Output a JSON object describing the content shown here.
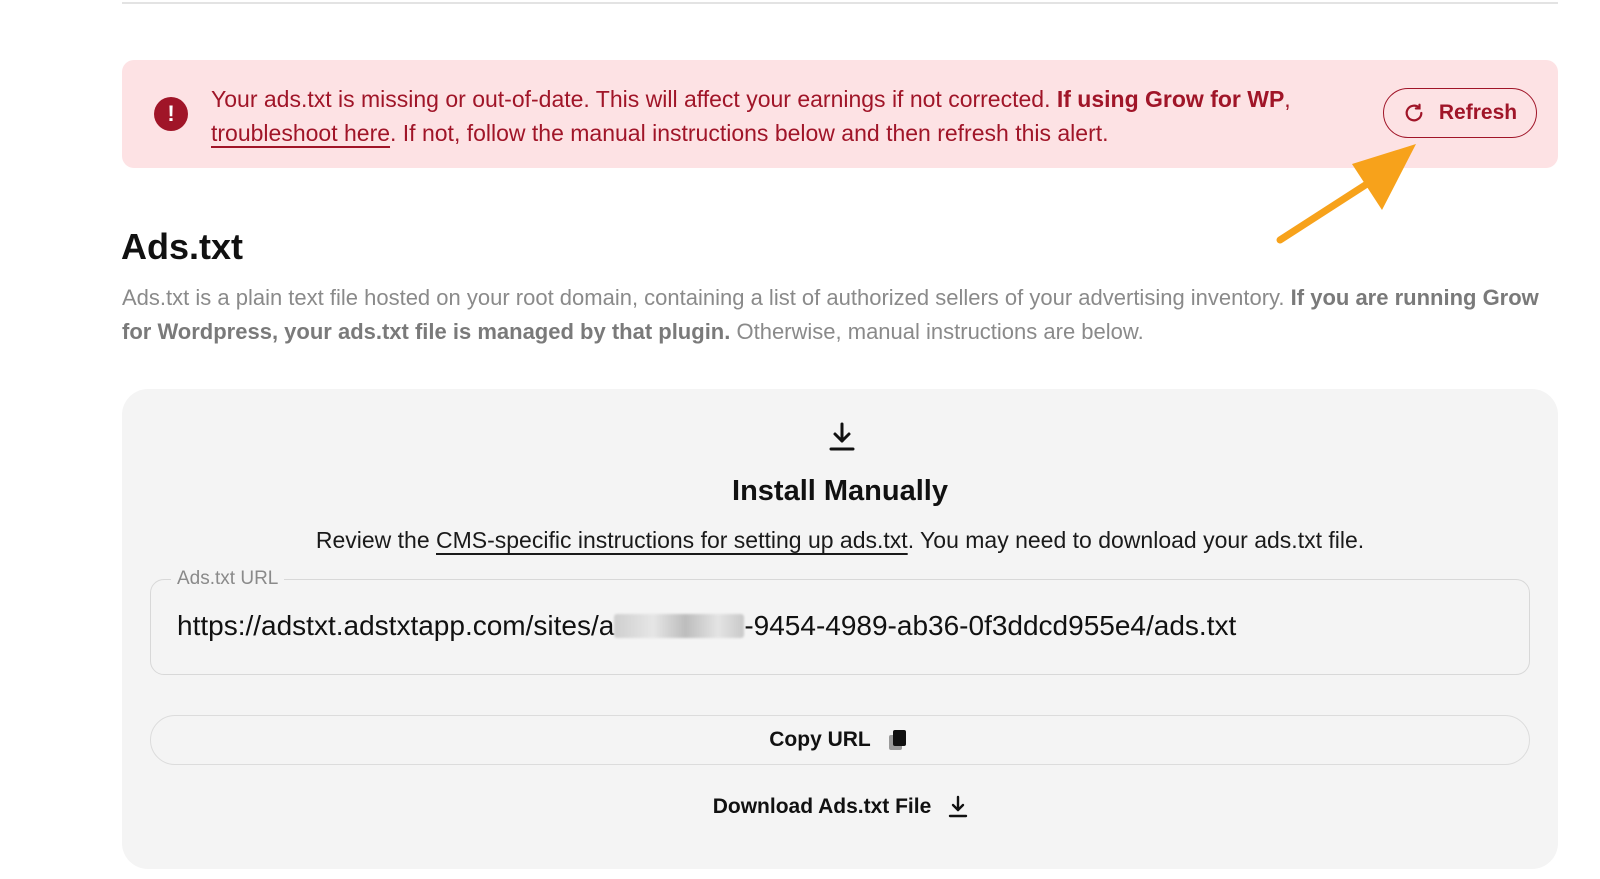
{
  "alert": {
    "message_part1": "Your ads.txt is missing or out-of-date. This will affect your earnings if not corrected.",
    "bold_part": "If using Grow for WP",
    "comma": ",",
    "link": "troubleshoot here",
    "message_part2": ". If not, follow the manual instructions below and then refresh this alert.",
    "refresh_label": "Refresh",
    "icon": "exclamation-circle-icon",
    "color": "#a01528",
    "background": "#fde2e4"
  },
  "annotation": {
    "arrow_color": "#f7a21b"
  },
  "section": {
    "title": "Ads.txt",
    "desc_part1": "Ads.txt is a plain text file hosted on your root domain, containing a list of authorized sellers of your advertising inventory.",
    "desc_bold": "If you are running Grow for Wordpress, your ads.txt file is managed by that plugin.",
    "desc_part2": "Otherwise, manual instructions are below."
  },
  "card": {
    "icon": "download-icon",
    "title": "Install Manually",
    "desc_prefix": "Review the",
    "desc_link": "CMS-specific instructions for setting up ads.txt",
    "desc_suffix": ". You may need to download your ads.txt file.",
    "url_label": "Ads.txt URL",
    "url_prefix": "https://adstxt.adstxtapp.com/sites/a",
    "url_suffix": "-9454-4989-ab36-0f3ddcd955e4/ads.txt",
    "copy_label": "Copy URL",
    "copy_icon": "copy-icon",
    "download_label": "Download Ads.txt File",
    "download_icon": "download-icon"
  }
}
